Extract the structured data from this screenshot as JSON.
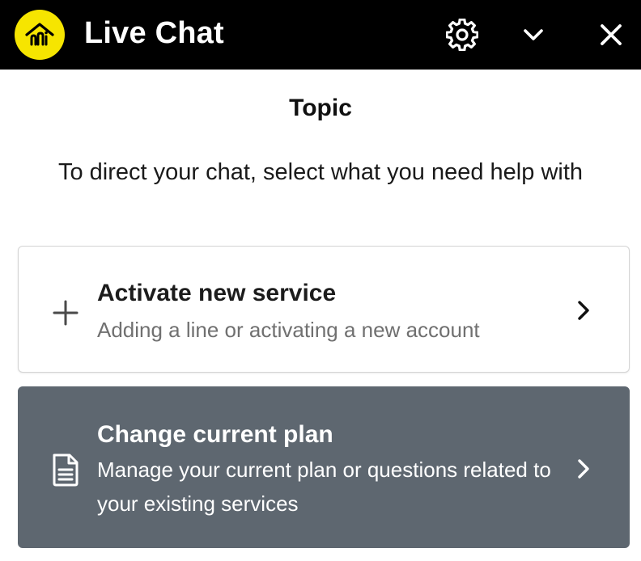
{
  "header": {
    "title": "Live Chat",
    "logo_icon": "home-logo-icon",
    "settings_icon": "gear-icon",
    "minimize_icon": "chevron-down-icon",
    "close_icon": "close-icon",
    "background_color": "#000000",
    "logo_color": "#f6e500"
  },
  "main": {
    "heading": "Topic",
    "instructions": "To direct your chat, select what you need help with",
    "options": [
      {
        "title": "Activate new service",
        "description": "Adding a line or activating a new account",
        "icon": "plus-icon",
        "chevron_icon": "chevron-right-icon",
        "selected": false
      },
      {
        "title": "Change current plan",
        "description": "Manage your current plan or questions related to your existing services",
        "icon": "document-icon",
        "chevron_icon": "chevron-right-icon",
        "selected": true,
        "background_color": "#5e6770"
      }
    ]
  }
}
